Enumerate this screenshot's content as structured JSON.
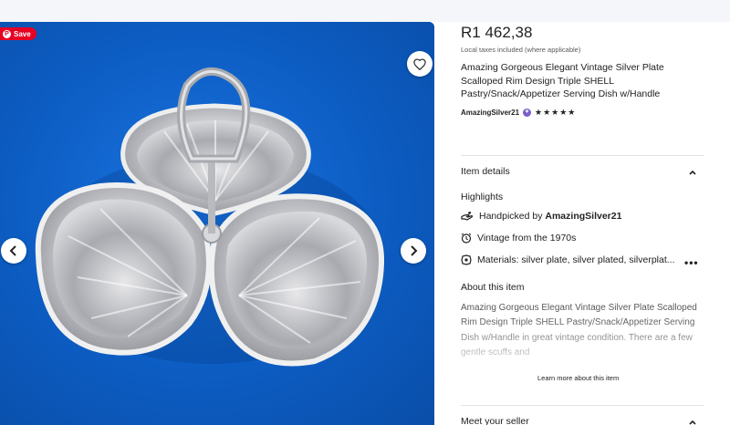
{
  "gallery": {
    "save_label": "Save",
    "pin_glyph": "P",
    "favorite_icon": "heart-icon",
    "prev_icon": "chevron-left-icon",
    "next_icon": "chevron-right-icon",
    "background_color": "#0e5fc8",
    "image_subject": "silver-shell-serving-dish"
  },
  "product": {
    "price": "R1 462,38",
    "taxes_note": "Local taxes included (where applicable)",
    "title": "Amazing Gorgeous Elegant Vintage Silver Plate Scalloped Rim Design Triple SHELL Pastry/Snack/Appetizer Serving Dish w/Handle",
    "shop_name": "AmazingSilver21",
    "rating_stars": "★★★★★",
    "rating": 5,
    "star_seller_badge_color": "#7c5fc7"
  },
  "sections": {
    "item_details": "Item details",
    "highlights": "Highlights",
    "about_item": "About this item",
    "meet_seller": "Meet your seller"
  },
  "highlights": {
    "handpicked_prefix": "Handpicked by ",
    "handpicked_shop": "AmazingSilver21",
    "vintage": "Vintage from the 1970s",
    "materials": "Materials: silver plate, silver plated, silverplat...",
    "more_dots": "•••"
  },
  "about": {
    "description": "Amazing Gorgeous Elegant Vintage Silver Plate Scalloped Rim Design Triple SHELL Pastry/Snack/Appetizer Serving Dish w/Handle in great vintage condition. There are a few gentle scuffs and",
    "learn_more": "Learn more about this item"
  }
}
